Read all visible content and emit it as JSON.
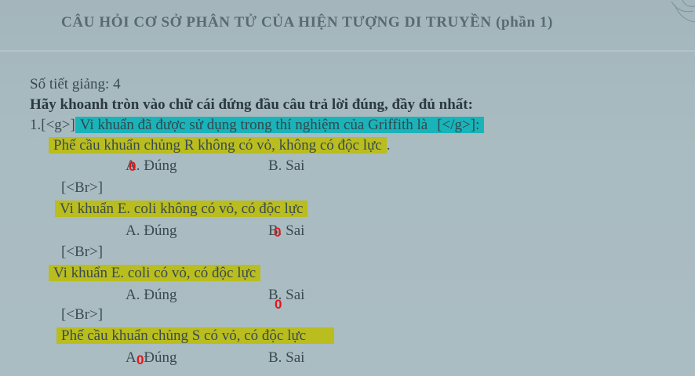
{
  "title": "CÂU HỎI CƠ SỞ PHÂN TỬ CỦA HIỆN TƯỢNG DI TRUYỀN (phần 1)",
  "lesson_hours": "Số tiết giảng: 4",
  "instruction": "Hãy khoanh tròn vào chữ cái đứng đầu câu trả lời đúng, đầy đủ nhất:",
  "question": {
    "number": "1.",
    "tag_open": "[<g>]",
    "text": "Vi khuẩn đã được sử dụng trong thí nghiệm của Griffith là",
    "tag_close": "[</g>]:",
    "statements": [
      {
        "text": "Phế cầu khuẩn chủng R không có vỏ, không có độc lực",
        "suffix": ".",
        "option_a": "A. Đúng",
        "option_b": "B. Sai",
        "mark": "0"
      },
      {
        "separator": "[<Br>]",
        "text": "Vi khuẩn E. coli không có vỏ, có độc lực",
        "option_a": "A. Đúng",
        "option_b": "B. Sai",
        "mark": "0"
      },
      {
        "separator": "[<Br>]",
        "text": "Vi khuẩn E. coli có vỏ, có độc lực",
        "option_a": "A. Đúng",
        "option_b": "B. Sai",
        "mark": "0"
      },
      {
        "separator": "[<Br>]",
        "text": "Phế cầu khuẩn chủng S có vỏ, có độc lực",
        "option_a": "A. Đúng",
        "option_b": "B. Sai",
        "mark": "0"
      }
    ]
  },
  "colors": {
    "highlight_yellow": "#b9bd1e",
    "highlight_cyan": "#18b4b9",
    "mark_red": "#e0181c"
  }
}
